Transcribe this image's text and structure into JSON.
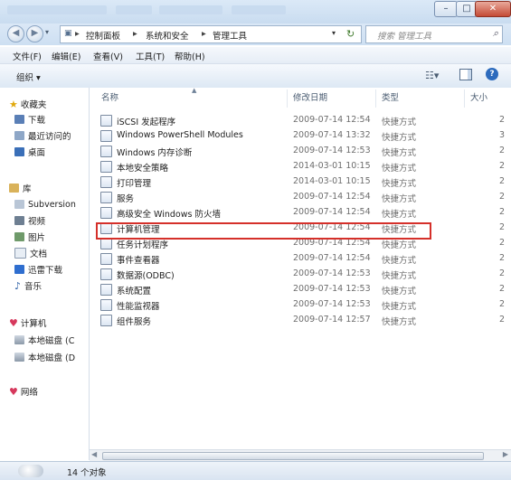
{
  "address": {
    "crumbs": [
      "控制面板",
      "系统和安全",
      "管理工具"
    ],
    "search_placeholder": "搜索 管理工具"
  },
  "window_buttons": {
    "minimize": "–",
    "maximize": "□",
    "close": "✕"
  },
  "menu": [
    "文件(F)",
    "编辑(E)",
    "查看(V)",
    "工具(T)",
    "帮助(H)"
  ],
  "toolbar": {
    "organize": "组织 ▾"
  },
  "sidebar": {
    "favorites": {
      "label": "收藏夹",
      "items": [
        "下载",
        "最近访问的",
        "桌面"
      ]
    },
    "libraries": {
      "label": "库",
      "items": [
        "Subversion",
        "视频",
        "图片",
        "文档",
        "迅雷下载",
        "音乐"
      ]
    },
    "computer": {
      "label": "计算机",
      "items": [
        "本地磁盘 (C",
        "本地磁盘 (D"
      ]
    },
    "network": {
      "label": "网络"
    }
  },
  "columns": {
    "name": "名称",
    "modified": "修改日期",
    "type": "类型",
    "size": "大小"
  },
  "files": [
    {
      "name": "iSCSI 发起程序",
      "date": "2009-07-14 12:54",
      "type": "快捷方式",
      "size": "2"
    },
    {
      "name": "Windows PowerShell Modules",
      "date": "2009-07-14 13:32",
      "type": "快捷方式",
      "size": "3"
    },
    {
      "name": "Windows 内存诊断",
      "date": "2009-07-14 12:53",
      "type": "快捷方式",
      "size": "2"
    },
    {
      "name": "本地安全策略",
      "date": "2014-03-01 10:15",
      "type": "快捷方式",
      "size": "2"
    },
    {
      "name": "打印管理",
      "date": "2014-03-01 10:15",
      "type": "快捷方式",
      "size": "2"
    },
    {
      "name": "服务",
      "date": "2009-07-14 12:54",
      "type": "快捷方式",
      "size": "2"
    },
    {
      "name": "高级安全 Windows 防火墙",
      "date": "2009-07-14 12:54",
      "type": "快捷方式",
      "size": "2"
    },
    {
      "name": "计算机管理",
      "date": "2009-07-14 12:54",
      "type": "快捷方式",
      "size": "2"
    },
    {
      "name": "任务计划程序",
      "date": "2009-07-14 12:54",
      "type": "快捷方式",
      "size": "2"
    },
    {
      "name": "事件查看器",
      "date": "2009-07-14 12:54",
      "type": "快捷方式",
      "size": "2"
    },
    {
      "name": "数据源(ODBC)",
      "date": "2009-07-14 12:53",
      "type": "快捷方式",
      "size": "2"
    },
    {
      "name": "系统配置",
      "date": "2009-07-14 12:53",
      "type": "快捷方式",
      "size": "2"
    },
    {
      "name": "性能监视器",
      "date": "2009-07-14 12:53",
      "type": "快捷方式",
      "size": "2"
    },
    {
      "name": "组件服务",
      "date": "2009-07-14 12:57",
      "type": "快捷方式",
      "size": "2"
    }
  ],
  "status": {
    "count": "14 个对象"
  },
  "colors": {
    "highlight": "#d5302a",
    "chrome": "#dbe8f6"
  }
}
